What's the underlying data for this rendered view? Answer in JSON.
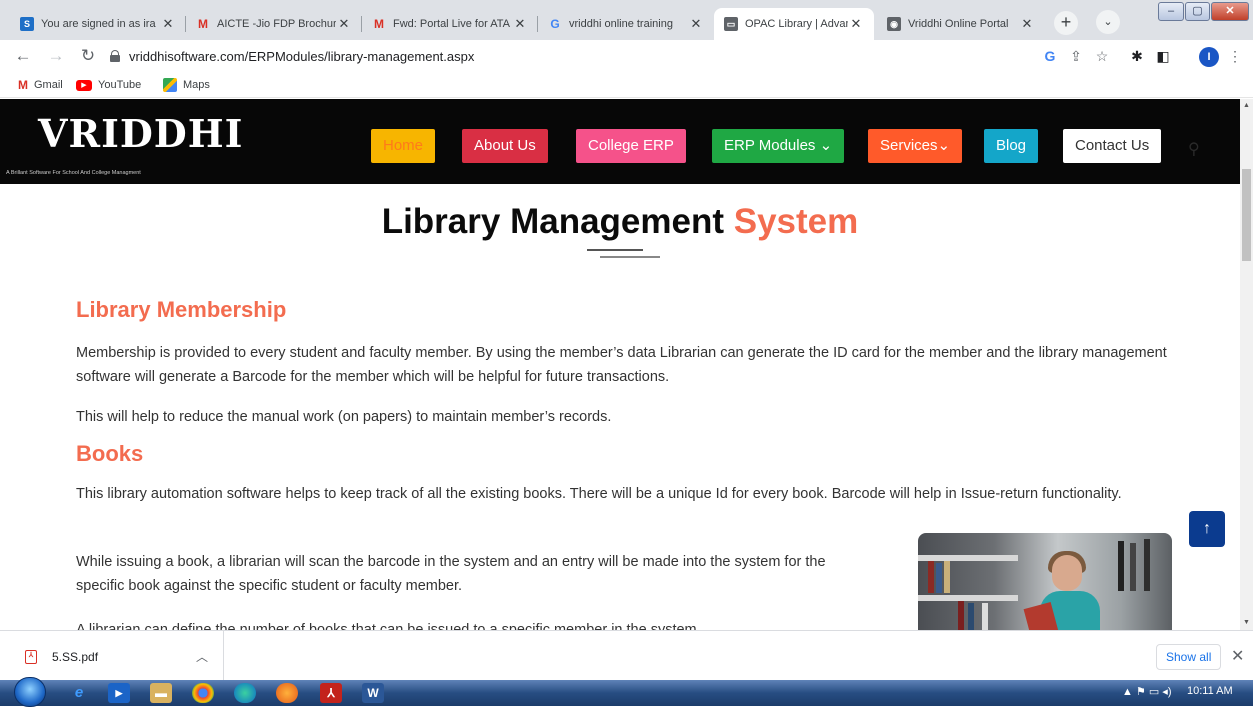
{
  "browser": {
    "tabs": [
      {
        "title": "You are signed in as ira",
        "icon": "S",
        "icon_color": "#1e6fc7",
        "active": false
      },
      {
        "title": "AICTE -Jio FDP Brochur",
        "icon": "M",
        "icon_color": "#d93025",
        "active": false
      },
      {
        "title": "Fwd: Portal Live for ATA",
        "icon": "M",
        "icon_color": "#d93025",
        "active": false
      },
      {
        "title": "vriddhi online training",
        "icon": "G",
        "icon_color": "#4285f4",
        "active": false
      },
      {
        "title": "OPAC Library | Advance",
        "icon": "▭",
        "icon_color": "#5f6368",
        "active": true
      },
      {
        "title": "Vriddhi Online Portal",
        "icon": "◉",
        "icon_color": "#5f6368",
        "active": false
      }
    ],
    "url": "vriddhisoftware.com/ERPModules/library-management.aspx",
    "bookmarks": [
      {
        "label": "Gmail",
        "icon": "gmail-icon"
      },
      {
        "label": "YouTube",
        "icon": "youtube-icon"
      },
      {
        "label": "Maps",
        "icon": "maps-icon"
      }
    ],
    "profile_initial": "I"
  },
  "site": {
    "logo": "VRIDDHI",
    "tagline": "A Brillant Software For School And College Managment",
    "nav": [
      {
        "label": "Home",
        "color": "#f7b500",
        "text_color": "#ff7a1a"
      },
      {
        "label": "About Us",
        "color": "#d92f44",
        "text_color": "#ffffff"
      },
      {
        "label": "College ERP",
        "color": "#f5528a",
        "text_color": "#ffffff"
      },
      {
        "label": "ERP Modules ⌄",
        "color": "#1fa844",
        "text_color": "#ffffff"
      },
      {
        "label": "Services⌄",
        "color": "#ff5a2a",
        "text_color": "#ffffff"
      },
      {
        "label": "Blog",
        "color": "#14a6c9",
        "text_color": "#ffffff"
      },
      {
        "label": "Contact Us",
        "color": "#ffffff",
        "text_color": "#333333"
      }
    ]
  },
  "content": {
    "title_main": "Library Management ",
    "title_accent": "System",
    "sections": [
      {
        "heading": "Library Membership",
        "paragraphs": [
          "Membership is provided to every student and faculty member. By using the member’s data Librarian can generate the ID card for the member and the library management software will generate a Barcode for the member which will be helpful for future transactions.",
          "This will help to reduce the manual work (on papers) to maintain member’s records."
        ]
      },
      {
        "heading": "Books",
        "paragraphs": [
          "This library automation software helps to keep track of all the existing books. There will be a unique Id for every book. Barcode will help in Issue-return functionality.",
          "While issuing a book, a librarian will scan the barcode in the system and an entry will be made into the system for the specific book against the specific student or faculty member.",
          "A librarian can define the number of books that can be issued to a specific member in the system."
        ]
      }
    ]
  },
  "downloads": {
    "file": "5.SS.pdf",
    "show_all": "Show all"
  },
  "taskbar": {
    "time": "10:11 AM"
  }
}
